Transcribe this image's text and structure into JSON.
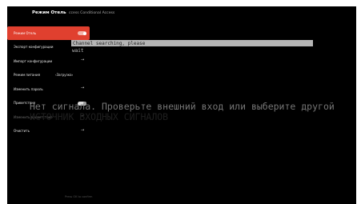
{
  "header": {
    "title": "Режим Отель",
    "subtitle": "ccess Conditional Access"
  },
  "menu": {
    "items": [
      {
        "label": "Режим Отель",
        "control": "toggle",
        "state": "on",
        "active": true
      },
      {
        "label": "Экспорт конфигурации",
        "control": "arrow",
        "arrow": "→"
      },
      {
        "label": "Импорт конфигурации",
        "control": "arrow",
        "arrow": "→"
      },
      {
        "label": "Режим питания",
        "control": "value",
        "value": "‹Загрузка›"
      },
      {
        "label": "Изменить пароль",
        "control": "arrow",
        "arrow": "→"
      },
      {
        "label": "Приветствие",
        "control": "toggle",
        "state": "on"
      },
      {
        "label": "Изменить приветствие",
        "control": "arrow",
        "arrow": "→",
        "dim": true
      },
      {
        "label": "Очистить",
        "control": "arrow",
        "arrow": "→"
      }
    ]
  },
  "footer": {
    "text": "Press OK to confirm"
  },
  "status": {
    "line1": "Channel searching, please",
    "line2": "wait"
  },
  "overlay": {
    "line1": "Нет сигнала. Проверьте внешний вход или выберите другой",
    "line2": "ИСТОЧНИК ВХОДНЫХ СИГНАЛОВ"
  }
}
